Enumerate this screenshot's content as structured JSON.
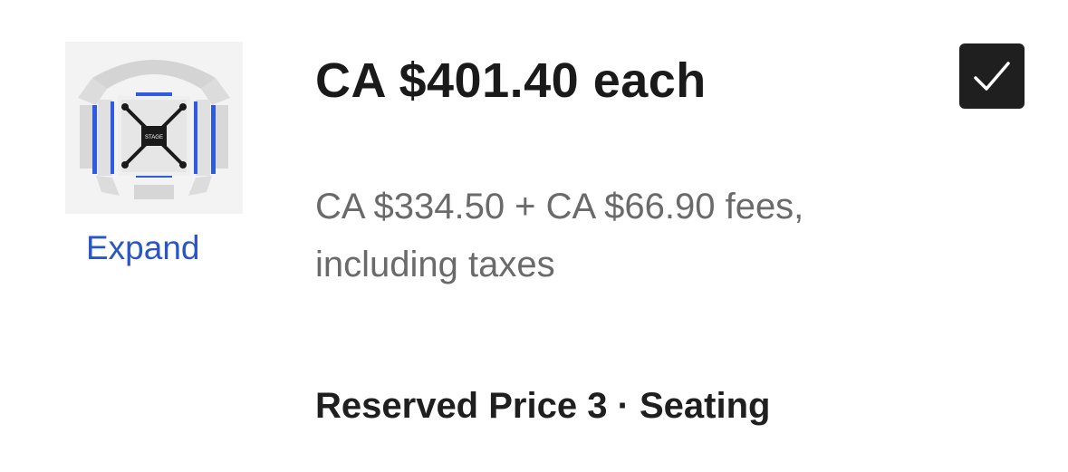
{
  "seat_map": {
    "icon": "seat-map-icon",
    "stage_label": "STAGE",
    "expand_label": "Expand"
  },
  "ticket": {
    "price_each": "CA $401.40 each",
    "breakdown_line1": "CA $334.50 + CA $66.90 fees,",
    "breakdown_line2": "including taxes",
    "section": "Reserved Price 3 · Seating",
    "selected": true
  },
  "colors": {
    "accent_link": "#2a55c4",
    "checkbox_bg": "#1f1f1f",
    "highlighted_seats": "#2f5be0"
  }
}
